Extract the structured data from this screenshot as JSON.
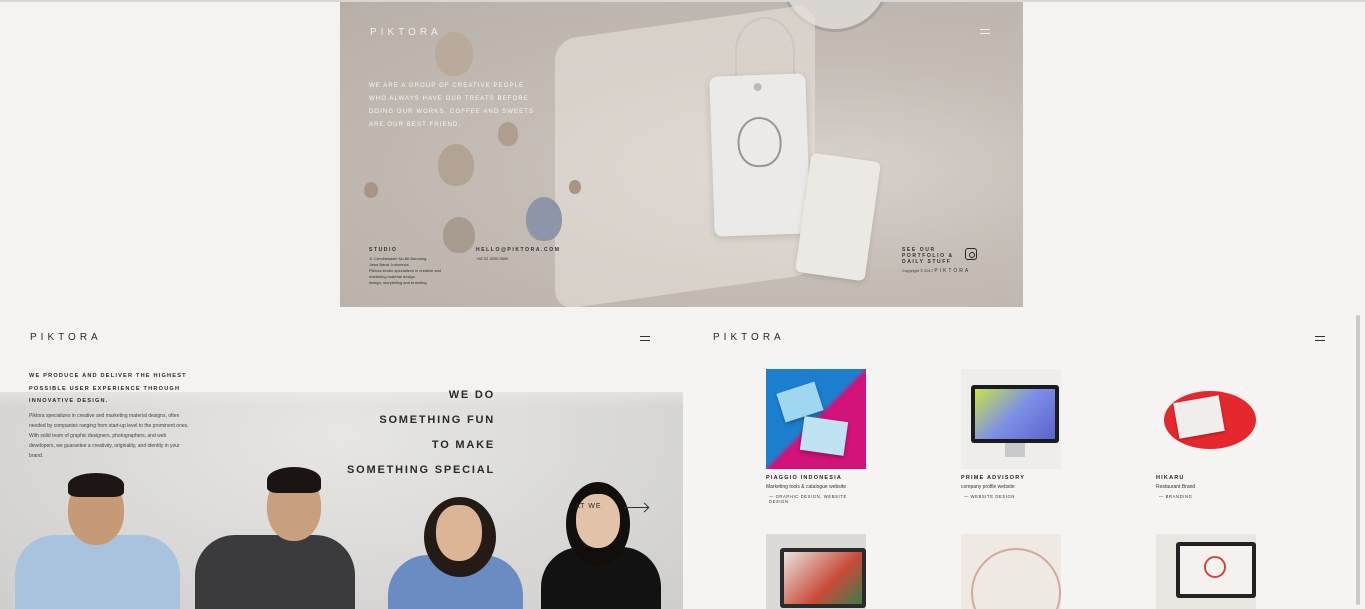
{
  "hero": {
    "logo": "PIKTORA",
    "about": "WE ARE A GROUP OF CREATIVE PEOPLE WHO ALWAYS HAVE OUR TREATS BEFORE DOING OUR WORKS. COFFEE AND SWEETS ARE OUR BEST FRIEND.",
    "studio_label": "STUDIO",
    "studio_lines": [
      "Jl. Cendrawasih No.86 Bandung",
      "Jawa Barat, Indonesia",
      "Piktora studio specializes in creative and",
      "marketing material design",
      "design, storytelling and branding"
    ],
    "email_label": "HELLO@PIKTORA.COM",
    "phone": "+62 22 2000 0000",
    "portfolio_label": "SEE OUR PORTFOLIO & DAILY STUFF",
    "copyright": "Copyright © 2017",
    "copyright_brand": "PIKTORA"
  },
  "left_panel": {
    "logo": "PIKTORA",
    "heading": "WE PRODUCE AND DELIVER THE HIGHEST POSSIBLE USER EXPERIENCE THROUGH INNOVATIVE DESIGN.",
    "body": "Piktora specializes in creative and marketing material designs, often needed by companies ranging from start-up level to the prominent ones. With solid team of graphic designers, photographers, and web developers, we guarantee a creativity, originality, and identity in your brand.",
    "tagline": [
      "WE DO",
      "SOMETHING FUN",
      "TO MAKE",
      "SOMETHING SPECIAL"
    ],
    "meet_label": "AT WE"
  },
  "right_panel": {
    "logo": "PIKTORA",
    "cards": [
      {
        "title": "PIAGGIO INDONESIA",
        "subtitle": "Marketing tools & catalogue website",
        "tags": "GRAPHIC DESIGN, WEBSITE DESIGN"
      },
      {
        "title": "PRIME ADVISORY",
        "subtitle": "company profile website",
        "tags": "WEBSITE DESIGN"
      },
      {
        "title": "HIKARU",
        "subtitle": "Restaurant Brand",
        "tags": "BRANDING"
      }
    ]
  },
  "colors": {
    "background": "#f4f3f1",
    "hero_overlay": "#c4bcb5",
    "text_dark": "#1f1f1f",
    "piaggio_blue": "#1d7fd0",
    "piaggio_magenta": "#d3127a",
    "hikaru_red": "#e5282e"
  }
}
